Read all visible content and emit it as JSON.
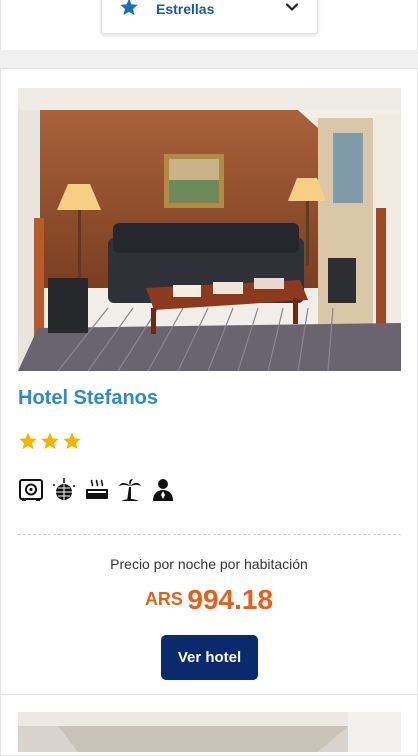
{
  "filter": {
    "label": "Estrellas",
    "icon": "star-icon"
  },
  "hotel": {
    "name": "Hotel Stefanos",
    "stars": 3,
    "amenities": [
      "safe-icon",
      "disco-ball-icon",
      "hot-tub-icon",
      "palm-tree-icon",
      "concierge-icon"
    ],
    "price_caption": "Precio por noche por habitación",
    "currency": "ARS",
    "price": "994.18",
    "button_label": "Ver hotel"
  },
  "colors": {
    "accent_blue": "#2a8ad0",
    "filter_text": "#1a5a9a",
    "star": "#f5b400",
    "price": "#e85f19",
    "button": "#0b2a6e"
  }
}
